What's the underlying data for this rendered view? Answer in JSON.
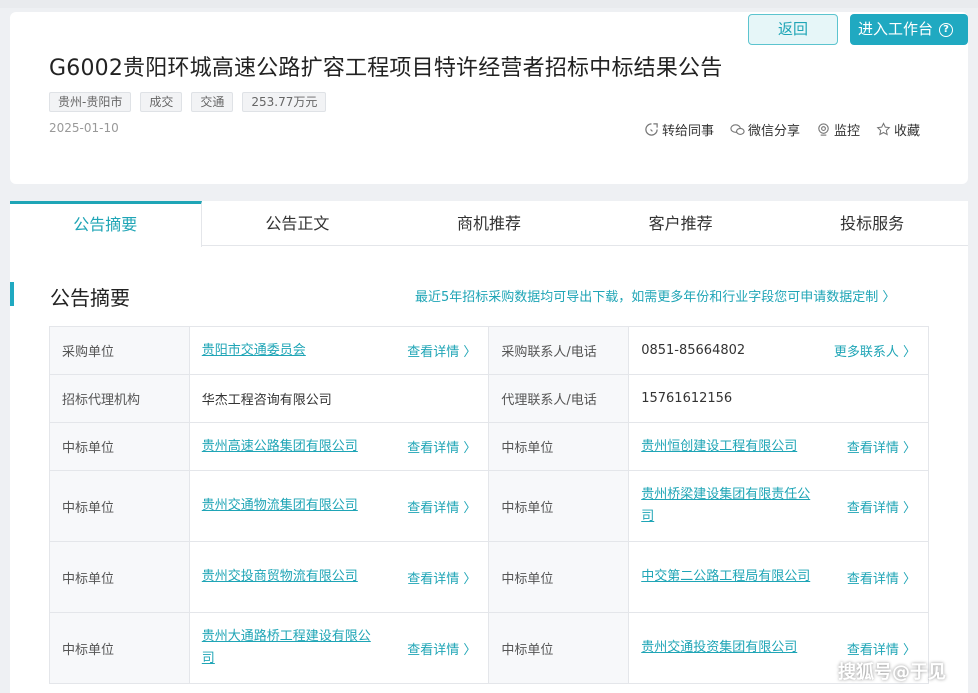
{
  "header": {
    "back_label": "返回",
    "workbench_label": "进入工作台",
    "title": "G6002贵阳环城高速公路扩容工程项目特许经营者招标中标结果公告",
    "tags": [
      "贵州-贵阳市",
      "成交",
      "交通",
      "253.77万元"
    ],
    "date": "2025-01-10",
    "actions": {
      "forward": "转给同事",
      "wechat": "微信分享",
      "monitor": "监控",
      "favorite": "收藏"
    }
  },
  "tabs": [
    "公告摘要",
    "公告正文",
    "商机推荐",
    "客户推荐",
    "投标服务"
  ],
  "summary": {
    "title": "公告摘要",
    "export_text": "最近5年招标采购数据均可导出下载，如需更多年份和行业字段您可申请数据定制 〉"
  },
  "table": {
    "detail_label": "查看详情 〉",
    "more_contacts": "更多联系人 〉",
    "purchaser_label": "采购单位",
    "purchaser": "贵阳市交通委员会",
    "purchaser_contact_label": "采购联系人/电话",
    "purchaser_phone": "0851-85664802",
    "agency_label": "招标代理机构",
    "agency": "华杰工程咨询有限公司",
    "agency_contact_label": "代理联系人/电话",
    "agency_phone": "15761612156",
    "winner_label": "中标单位",
    "winners_left": [
      "贵州高速公路集团有限公司",
      "贵州交通物流集团有限公司",
      "贵州交投商贸物流有限公司",
      "贵州大通路桥工程建设有限公司"
    ],
    "winners_right": [
      "贵州恒创建设工程有限公司",
      "贵州桥梁建设集团有限责任公司",
      "中交第二公路工程局有限公司",
      "贵州交通投资集团有限公司"
    ]
  },
  "watermark": "搜狐号@于见"
}
